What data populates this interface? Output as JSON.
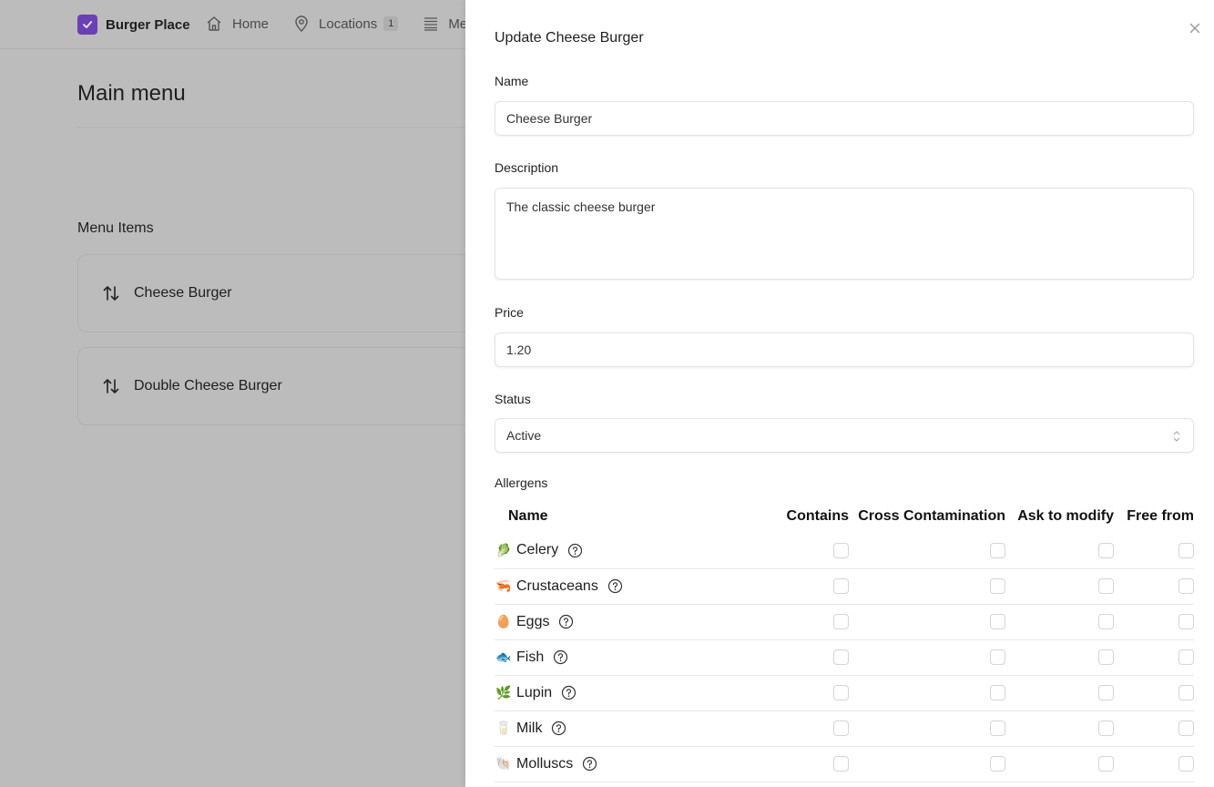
{
  "header": {
    "brand": "Burger Place",
    "nav": [
      {
        "label": "Home",
        "icon": "home-icon"
      },
      {
        "label": "Locations",
        "icon": "map-pin-icon",
        "badge": "1"
      },
      {
        "label": "Me",
        "icon": "menu-list-icon"
      }
    ]
  },
  "page": {
    "title": "Main menu",
    "section_title": "Menu Items",
    "items": [
      {
        "label": "Cheese Burger",
        "icon": "reorder-arrows-icon"
      },
      {
        "label": "Double Cheese Burger",
        "icon": "reorder-arrows-icon"
      }
    ]
  },
  "drawer": {
    "title": "Update Cheese Burger",
    "close_icon": "close-icon",
    "fields": {
      "name": {
        "label": "Name",
        "value": "Cheese Burger"
      },
      "description": {
        "label": "Description",
        "value": "The classic cheese burger"
      },
      "price": {
        "label": "Price",
        "value": "1.20"
      },
      "status": {
        "label": "Status",
        "value": "Active"
      }
    },
    "allergens": {
      "label": "Allergens",
      "columns": [
        "Name",
        "Contains",
        "Cross Contamination",
        "Ask to modify",
        "Free from"
      ],
      "rows": [
        {
          "emoji": "🥬",
          "name": "Celery",
          "contains": false,
          "cross": false,
          "ask": false,
          "free": false
        },
        {
          "emoji": "🦐",
          "name": "Crustaceans",
          "contains": false,
          "cross": false,
          "ask": false,
          "free": false
        },
        {
          "emoji": "🥚",
          "name": "Eggs",
          "contains": false,
          "cross": false,
          "ask": false,
          "free": false
        },
        {
          "emoji": "🐟",
          "name": "Fish",
          "contains": false,
          "cross": false,
          "ask": false,
          "free": false
        },
        {
          "emoji": "🌿",
          "name": "Lupin",
          "contains": false,
          "cross": false,
          "ask": false,
          "free": false
        },
        {
          "emoji": "🥛",
          "name": "Milk",
          "contains": false,
          "cross": false,
          "ask": false,
          "free": false
        },
        {
          "emoji": "🐚",
          "name": "Molluscs",
          "contains": false,
          "cross": false,
          "ask": false,
          "free": false
        }
      ]
    }
  },
  "colors": {
    "brand": "#6b3fb5",
    "overlay": "#bcbcbc"
  }
}
